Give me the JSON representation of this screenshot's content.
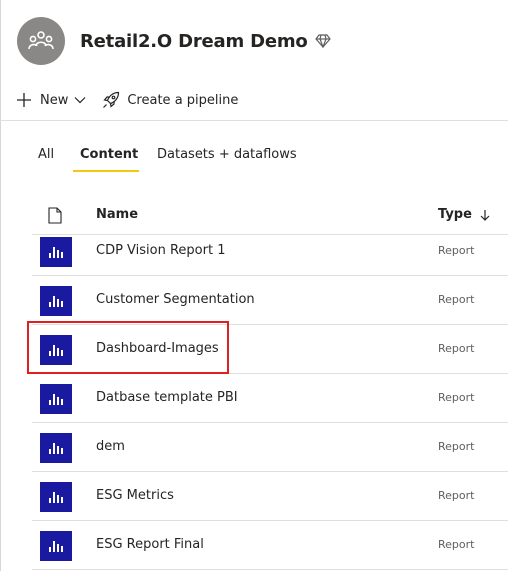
{
  "workspace": {
    "title": "Retail2.O Dream Demo",
    "avatar_icon": "people-group-icon",
    "premium_icon": "diamond-icon"
  },
  "toolbar": {
    "new_label": "New",
    "pipeline_label": "Create a pipeline"
  },
  "tabs": [
    {
      "label": "All",
      "active": false
    },
    {
      "label": "Content",
      "active": true
    },
    {
      "label": "Datasets + dataflows",
      "active": false
    }
  ],
  "table": {
    "columns": {
      "name": "Name",
      "type": "Type"
    },
    "sort": "descending",
    "rows": [
      {
        "name": "CDP Vision Report 1",
        "type": "Report"
      },
      {
        "name": "Customer Segmentation",
        "type": "Report"
      },
      {
        "name": "Dashboard-Images",
        "type": "Report",
        "highlighted": true
      },
      {
        "name": "Datbase template PBI",
        "type": "Report"
      },
      {
        "name": "dem",
        "type": "Report"
      },
      {
        "name": "ESG Metrics",
        "type": "Report"
      },
      {
        "name": "ESG Report Final",
        "type": "Report"
      }
    ]
  },
  "colors": {
    "accent_tab": "#f2c811",
    "report_icon_bg": "#1a1aa0",
    "highlight_box": "#e02020"
  }
}
